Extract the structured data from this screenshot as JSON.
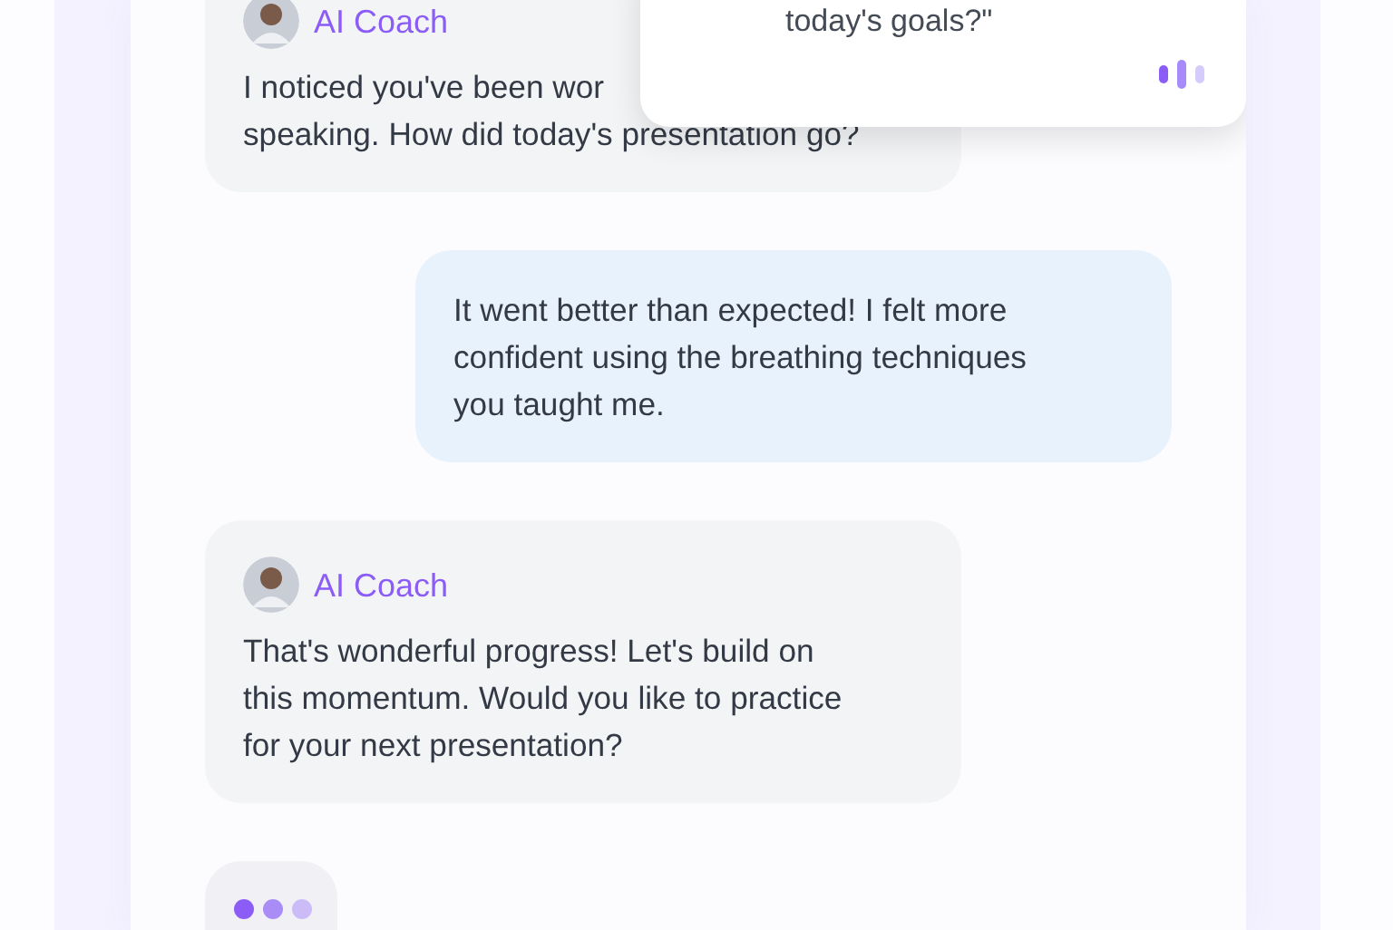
{
  "popup": {
    "text": "today's goals?\""
  },
  "messages": [
    {
      "kind": "coach",
      "sender": "AI Coach",
      "lines": [
        "I noticed you've been wor",
        "speaking. How did today's presentation go?"
      ]
    },
    {
      "kind": "user",
      "lines": [
        "It went better than expected! I felt more",
        "confident using the breathing techniques",
        "you taught me."
      ]
    },
    {
      "kind": "coach",
      "sender": "AI Coach",
      "lines": [
        "That's wonderful progress! Let's build on",
        "this momentum. Would you like to practice",
        "for your next presentation?"
      ]
    },
    {
      "kind": "typing"
    }
  ]
}
